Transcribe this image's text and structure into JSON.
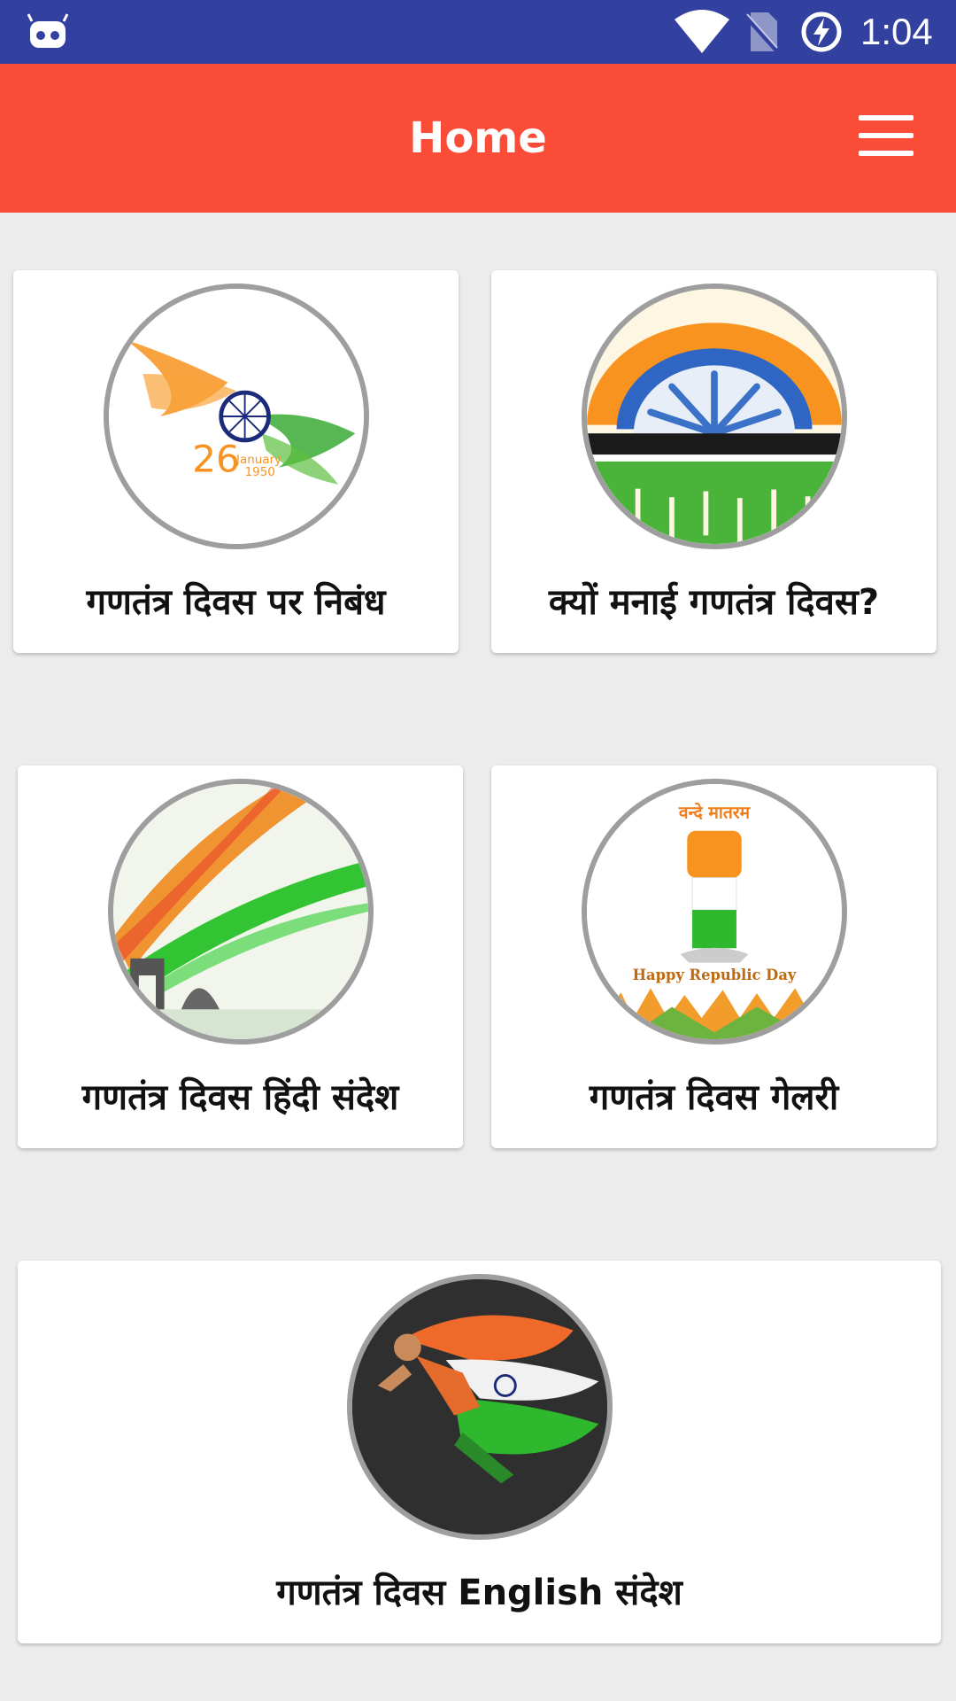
{
  "status_bar": {
    "time": "1:04",
    "icons": [
      "android-robot-icon",
      "wifi-icon",
      "no-sim-icon",
      "battery-charging-icon"
    ],
    "background": "#32409f"
  },
  "app_bar": {
    "title": "Home",
    "menu_icon": "hamburger-menu-icon",
    "background": "#fb4c38"
  },
  "cards": [
    {
      "label": "गणतंत्र दिवस पर निबंध",
      "image": "tricolor-feather-26-january-image"
    },
    {
      "label": "क्यों मनाई गणतंत्र दिवस?",
      "image": "ashoka-chakra-crowd-image"
    },
    {
      "label": "गणतंत्र दिवस हिंदी संदेश",
      "image": "tricolor-india-gate-image"
    },
    {
      "label": "गणतंत्र दिवस गेलरी",
      "image": "tricolor-fist-image",
      "image_text": [
        "वन्दे मातरम",
        "Happy Republic Day"
      ]
    },
    {
      "label": "गणतंत्र दिवस English संदेश",
      "image": "running-man-flag-image"
    }
  ],
  "colors": {
    "saffron": "#f7931e",
    "green": "#2eb82e",
    "chakra": "#1b2a7a"
  }
}
